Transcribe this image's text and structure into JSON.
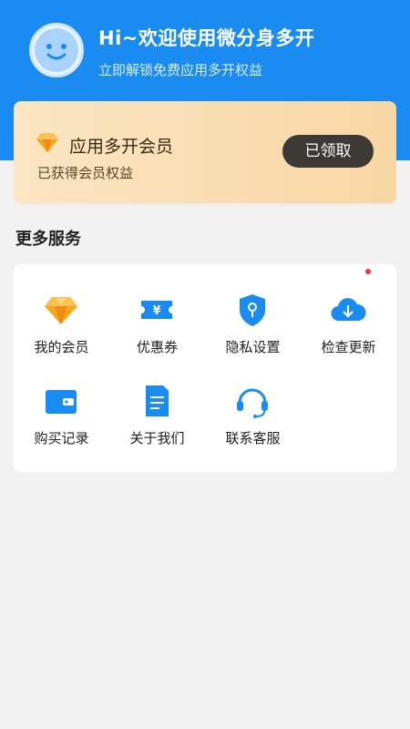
{
  "header": {
    "title": "Hi~欢迎使用微分身多开",
    "subtitle": "立即解锁免费应用多开权益",
    "avatar_icon": "smiley-face-icon"
  },
  "vip_card": {
    "icon": "diamond-icon",
    "title": "应用多开会员",
    "subtitle": "已获得会员权益",
    "button_label": "已领取"
  },
  "services": {
    "section_title": "更多服务",
    "items": [
      {
        "label": "我的会员",
        "icon": "diamond-icon"
      },
      {
        "label": "优惠券",
        "icon": "coupon-icon"
      },
      {
        "label": "隐私设置",
        "icon": "shield-icon"
      },
      {
        "label": "检查更新",
        "icon": "cloud-download-icon"
      },
      {
        "label": "购买记录",
        "icon": "wallet-icon"
      },
      {
        "label": "关于我们",
        "icon": "document-icon"
      },
      {
        "label": "联系客服",
        "icon": "headset-icon"
      }
    ]
  },
  "colors": {
    "header_blue": "#1a8bf0",
    "card_gold": "#f7d7a3",
    "button_dark": "#3d3a36",
    "icon_blue": "#1a8bf0",
    "icon_orange": "#f5a623",
    "badge_red": "#ee3a33"
  }
}
